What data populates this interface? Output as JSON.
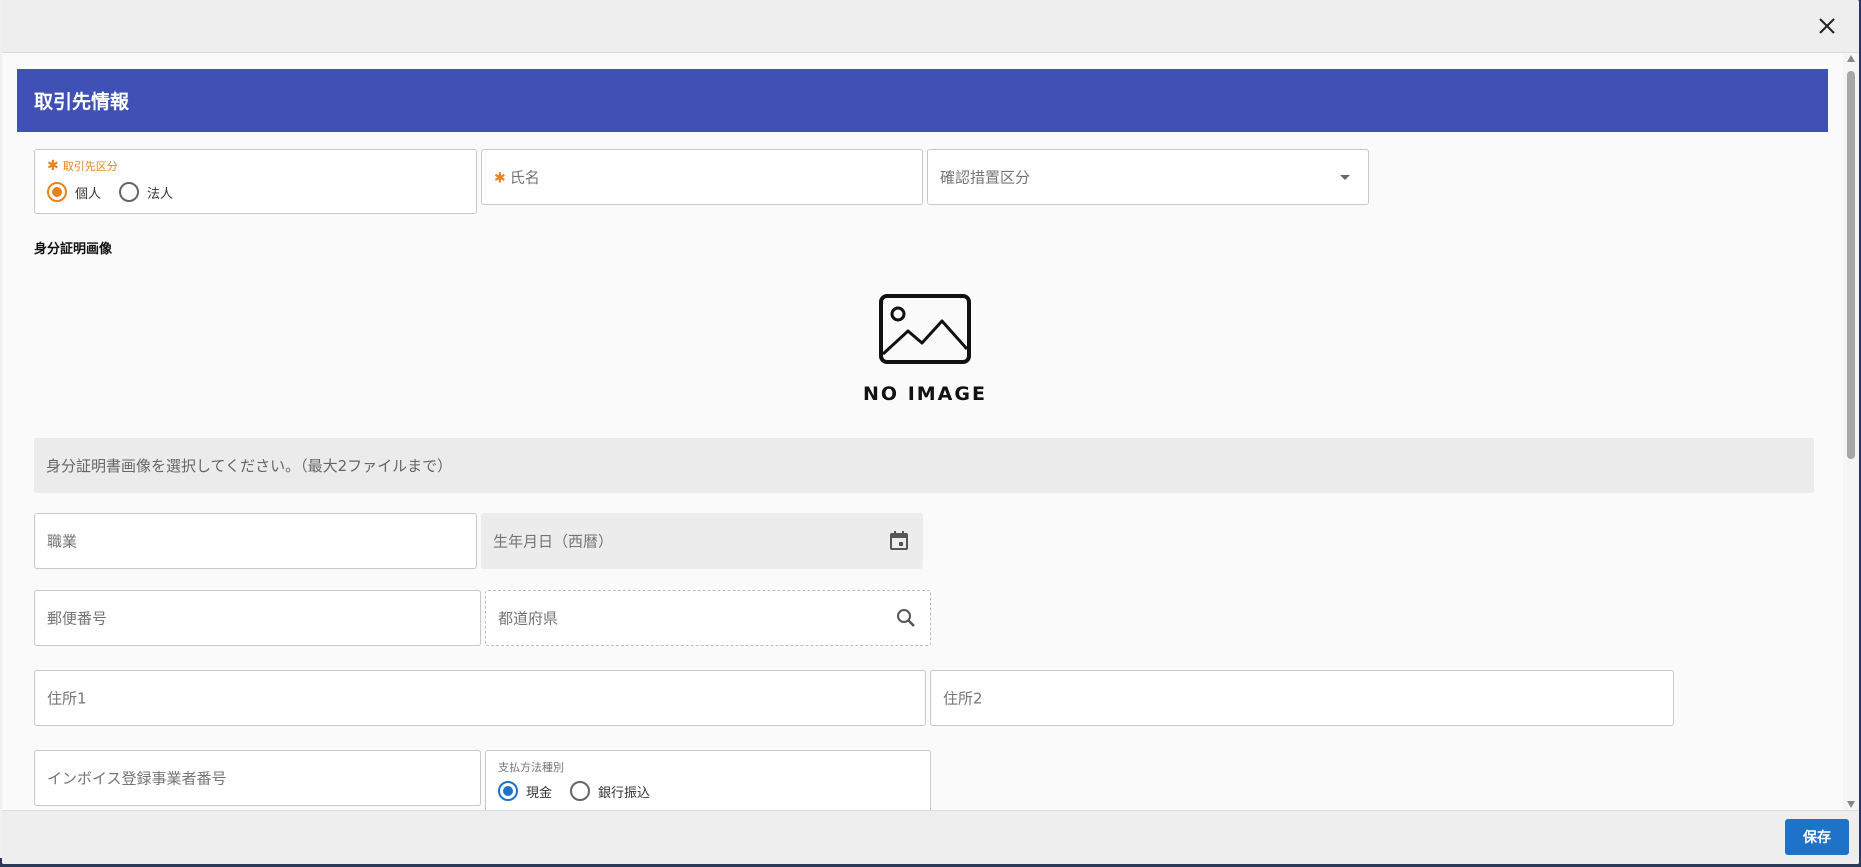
{
  "dialog": {
    "close_icon": "close-icon",
    "save_label": "保存"
  },
  "card": {
    "title": "取引先情報"
  },
  "fields": {
    "partner_type": {
      "label": "取引先区分",
      "options": [
        "個人",
        "法人"
      ],
      "selected": "個人"
    },
    "name": {
      "placeholder": "氏名",
      "required": true
    },
    "verification_type": {
      "placeholder": "確認措置区分"
    },
    "id_image_section": "身分証明画像",
    "no_image_text": "NO IMAGE",
    "upload_hint": "身分証明書画像を選択してください。（最大2ファイルまで）",
    "occupation": {
      "placeholder": "職業"
    },
    "birthdate": {
      "placeholder": "生年月日（西暦）"
    },
    "postal_code": {
      "placeholder": "郵便番号"
    },
    "prefecture": {
      "placeholder": "都道府県"
    },
    "address1": {
      "placeholder": "住所1"
    },
    "address2": {
      "placeholder": "住所2"
    },
    "invoice_number": {
      "placeholder": "インボイス登録事業者番号"
    },
    "payment_method": {
      "label": "支払方法種別",
      "options": [
        "現金",
        "銀行振込"
      ],
      "selected": "現金"
    }
  },
  "colors": {
    "header_blue": "#3f51b5",
    "required_orange": "#e8821c",
    "save_blue": "#1e73c9"
  }
}
